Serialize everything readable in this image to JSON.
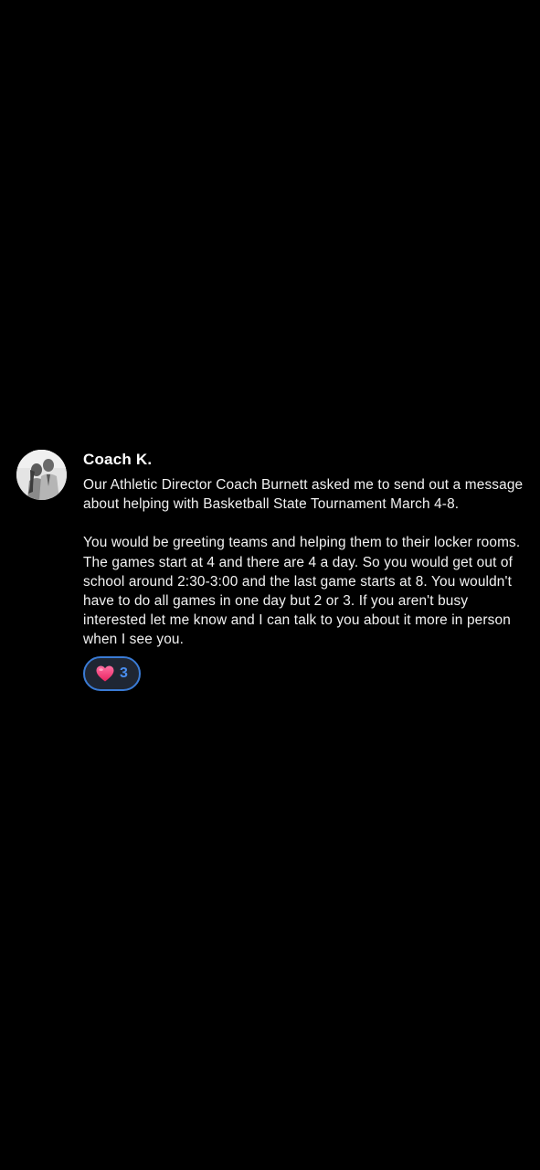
{
  "message": {
    "sender": "Coach K.",
    "paragraphs": [
      "Our Athletic Director Coach Burnett asked me to send out a message about helping with Basketball State Tournament March 4-8.",
      "You would be greeting teams and helping them to their locker rooms. The games start at 4 and there are 4 a day. So you would get out of school around 2:30-3:00 and the last game starts at 8. You wouldn't have to do all games in one day but 2 or 3. If you aren't busy interested let me know and I can talk to you about it more in person when I see you."
    ],
    "reaction": {
      "icon": "heart-icon",
      "count": "3",
      "accent_color": "#3a7bd5"
    }
  },
  "colors": {
    "background": "#000000",
    "text": "#ffffff",
    "reaction_count": "#4a8ef0"
  }
}
